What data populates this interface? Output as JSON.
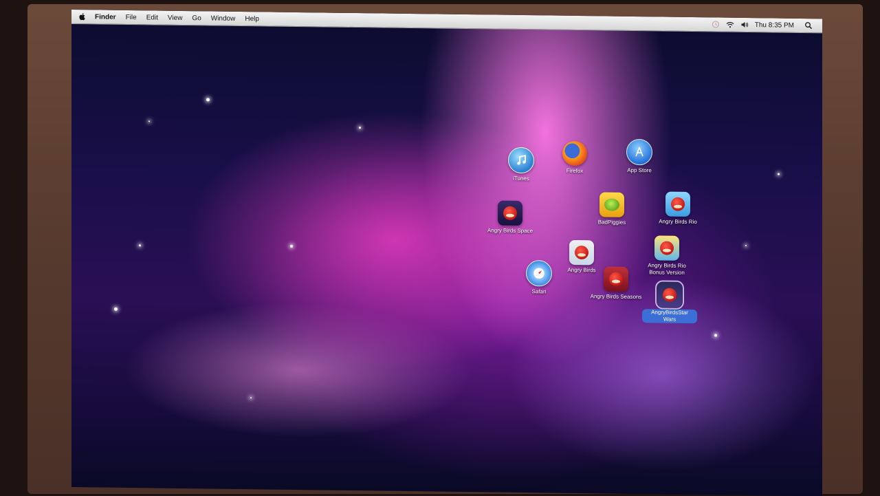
{
  "menubar": {
    "items": [
      {
        "label": "Finder",
        "bold": true
      },
      {
        "label": "File"
      },
      {
        "label": "Edit"
      },
      {
        "label": "View"
      },
      {
        "label": "Go"
      },
      {
        "label": "Window"
      },
      {
        "label": "Help"
      }
    ],
    "clock": "Thu 8:35 PM",
    "status_icons": [
      "time-machine-icon",
      "wifi-icon",
      "volume-icon"
    ],
    "search_icon": "spotlight-icon"
  },
  "desktop": {
    "icons": [
      {
        "id": "itunes",
        "label": "iTunes",
        "icon": "itunes-icon"
      },
      {
        "id": "firefox",
        "label": "Firefox",
        "icon": "firefox-icon"
      },
      {
        "id": "app-store",
        "label": "App Store",
        "icon": "app-store-icon"
      },
      {
        "id": "angry-birds-space",
        "label": "Angry Birds Space",
        "icon": "angry-birds-space-icon"
      },
      {
        "id": "bad-piggies",
        "label": "BadPiggies",
        "icon": "bad-piggies-icon"
      },
      {
        "id": "angry-birds-rio",
        "label": "Angry Birds Rio",
        "icon": "angry-birds-rio-icon"
      },
      {
        "id": "angry-birds",
        "label": "Angry Birds",
        "icon": "angry-birds-icon"
      },
      {
        "id": "angry-birds-rio-bonus",
        "label": "Angry Birds Rio Bonus Version",
        "icon": "angry-birds-rio-bonus-icon"
      },
      {
        "id": "safari",
        "label": "Safari",
        "icon": "safari-icon"
      },
      {
        "id": "angry-birds-seasons",
        "label": "Angry Birds Seasons",
        "icon": "angry-birds-seasons-icon"
      },
      {
        "id": "angry-birds-star-wars",
        "label": "AngryBirdsStar Wars",
        "icon": "angry-birds-star-wars-icon",
        "selected": true
      }
    ]
  },
  "colors": {
    "selection": "#3b6fd6",
    "menubar": "#e6e6e6",
    "wallpaper_pink": "#e03cc0",
    "wallpaper_deep": "#1a0f4a"
  }
}
